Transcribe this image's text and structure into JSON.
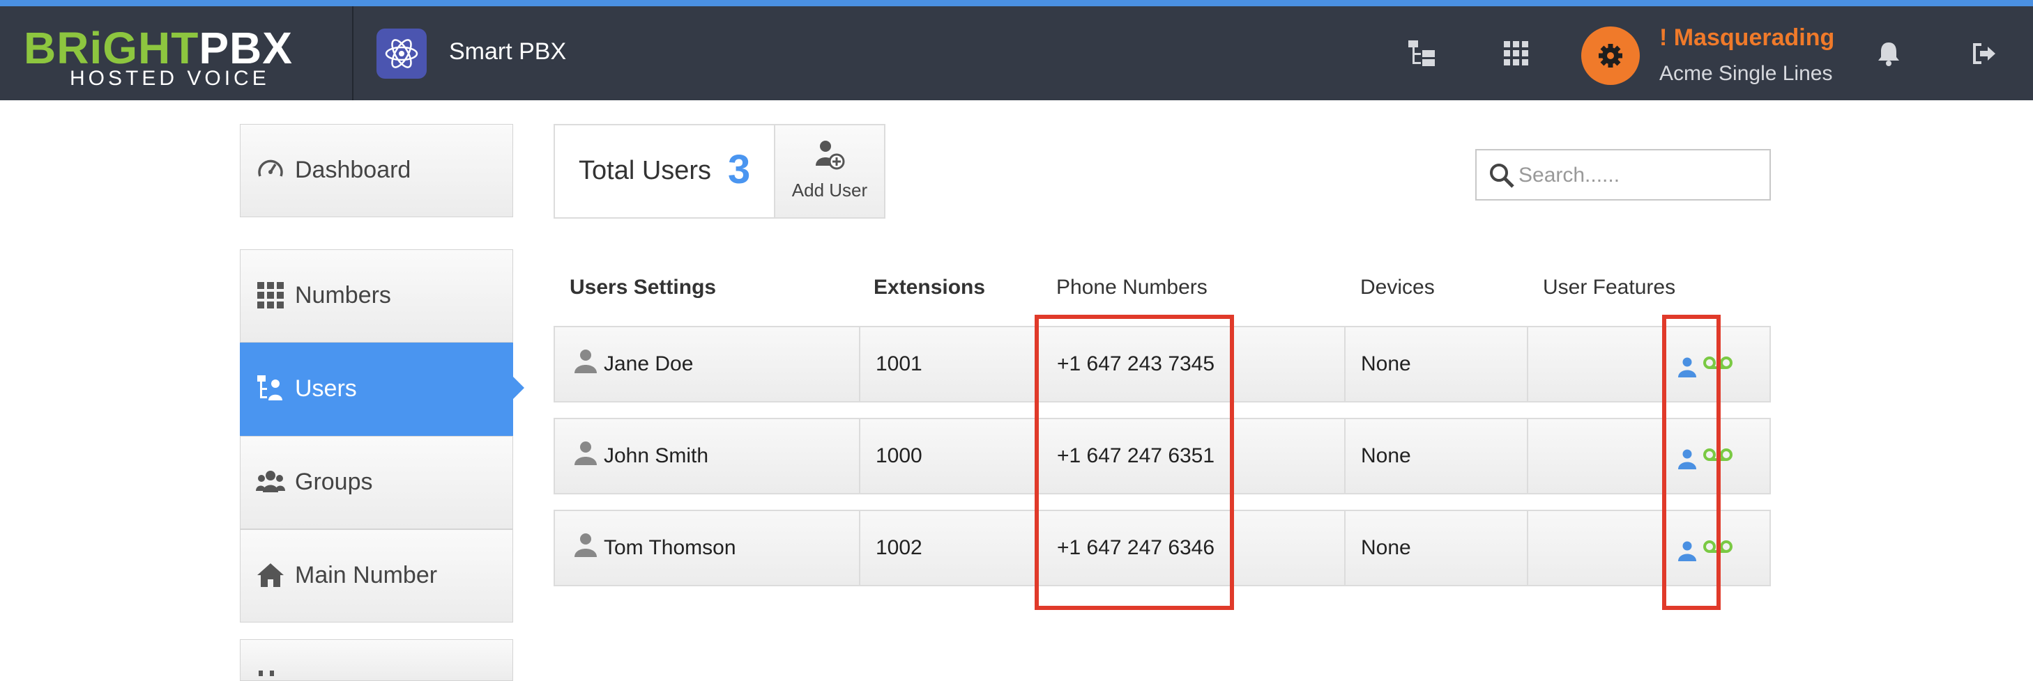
{
  "header": {
    "logo_main_green_1": "BR",
    "logo_main_white": "i",
    "logo_main_green_2": "GHT",
    "logo_main_white_2": "PBX",
    "logo_tagline": "HOSTED VOICE",
    "app_title": "Smart PBX",
    "masquerade_title": "! Masquerading",
    "masquerade_account": "Acme Single Lines"
  },
  "sidebar": {
    "items": [
      {
        "label": "Dashboard",
        "icon": "speedometer-icon"
      },
      {
        "label": "Numbers",
        "icon": "grid-icon"
      },
      {
        "label": "Users",
        "icon": "users-callflow-icon",
        "active": true
      },
      {
        "label": "Groups",
        "icon": "groups-icon"
      },
      {
        "label": "Main Number",
        "icon": "home-icon"
      }
    ]
  },
  "summary": {
    "total_label": "Total Users",
    "total_count": "3",
    "add_user_label": "Add User"
  },
  "search": {
    "placeholder": "Search......"
  },
  "table": {
    "headers": [
      "Users Settings",
      "Extensions",
      "Phone Numbers",
      "Devices",
      "User Features"
    ],
    "rows": [
      {
        "name": "Jane Doe",
        "extension": "1001",
        "phone": "+1 647 243 7345",
        "devices": "None"
      },
      {
        "name": "John Smith",
        "extension": "1000",
        "phone": "+1 647 247 6351",
        "devices": "None"
      },
      {
        "name": "Tom Thomson",
        "extension": "1002",
        "phone": "+1 647 247 6346",
        "devices": "None"
      }
    ]
  },
  "colors": {
    "accent_blue": "#4a95f0",
    "header_bg": "#343a46",
    "masquerade_orange": "#f07a2a",
    "logo_green": "#8dc63f",
    "voicemail_green": "#7ac943",
    "highlight_red": "#e03a2a"
  }
}
